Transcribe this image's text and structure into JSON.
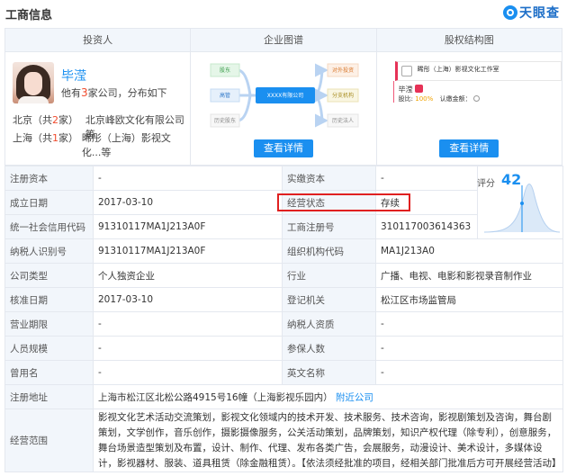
{
  "header": {
    "title": "工商信息",
    "brand": "天眼查"
  },
  "investor_panel": {
    "title": "投资人",
    "name": "毕滢",
    "desc_pre": "他有",
    "desc_count": "3",
    "desc_post": "家公司，分布如下",
    "rows": [
      {
        "loc_pre": "北京（共",
        "loc_count": "2",
        "loc_post": "家）",
        "company": "北京峰欧文化有限公司等"
      },
      {
        "loc_pre": "上海（共",
        "loc_count": "1",
        "loc_post": "家）",
        "company": "晞彤（上海）影视文化...等"
      }
    ]
  },
  "graph_panel": {
    "title": "企业图谱",
    "button": "查看详情",
    "center": "XXXX有限公司",
    "left_nodes": [
      "股东",
      "高管",
      "历史股东"
    ],
    "right_nodes": [
      "对外投资",
      "分支机构",
      "历史法人"
    ]
  },
  "equity_panel": {
    "title": "股权结构图",
    "button": "查看详情",
    "company": "晞彤（上海）影视文化工作室",
    "holder": "毕滢",
    "ratio_label": "股比:",
    "ratio_value": "100%",
    "sub_label": "认缴金额："
  },
  "score": {
    "label": "评分",
    "value": "42"
  },
  "table": {
    "rows": [
      [
        "注册资本",
        "-",
        "实缴资本",
        "-"
      ],
      [
        "成立日期",
        "2017-03-10",
        "经营状态",
        "存续"
      ],
      [
        "统一社会信用代码",
        "91310117MA1J213A0F",
        "工商注册号",
        "310117003614363"
      ],
      [
        "纳税人识别号",
        "91310117MA1J213A0F",
        "组织机构代码",
        "MA1J213A0"
      ],
      [
        "公司类型",
        "个人独资企业",
        "行业",
        "广播、电视、电影和影视录音制作业"
      ],
      [
        "核准日期",
        "2017-03-10",
        "登记机关",
        "松江区市场监管局"
      ],
      [
        "营业期限",
        "-",
        "纳税人资质",
        "-"
      ],
      [
        "人员规模",
        "-",
        "参保人数",
        "-"
      ],
      [
        "曾用名",
        "-",
        "英文名称",
        "-"
      ]
    ],
    "address_label": "注册地址",
    "address": "上海市松江区北松公路4915号16幢（上海影视乐园内）",
    "address_link": "附近公司",
    "scope_label": "经营范围",
    "scope": "影视文化艺术活动交流策划，影视文化领域内的技术开发、技术服务、技术咨询，影视剧策划及咨询，舞台剧策划，文学创作，音乐创作，摄影摄像服务，公关活动策划，品牌策划，知识产权代理（除专利），创意服务，舞台场景造型策划及布置，设计、制作、代理、发布各类广告，会展服务，动漫设计、美术设计，多媒体设计，影视器材、服装、道具租赁（除金融租赁）。【依法须经批准的项目，经相关部门批准后方可开展经营活动】"
  }
}
